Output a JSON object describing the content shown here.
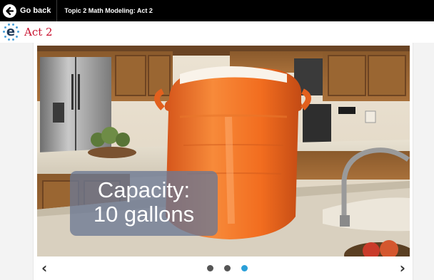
{
  "topbar": {
    "back_label": "Go back",
    "topic_title": "Topic 2 Math Modeling: Act 2"
  },
  "header": {
    "logo_icon": "e-logo-icon",
    "title": "Act 2"
  },
  "slide": {
    "caption_line1": "Capacity:",
    "caption_line2": "10 gallons",
    "image_subject": "orange water cooler on kitchen counter"
  },
  "carousel": {
    "prev_icon": "chevron-left-icon",
    "next_icon": "chevron-right-icon",
    "prev_label": "‹",
    "next_label": "›",
    "total_slides": 3,
    "active_index": 3
  },
  "colors": {
    "topbar_bg": "#000000",
    "title_red": "#c8102e",
    "active_dot": "#2a9fd8",
    "inactive_dot": "#555555",
    "cooler_orange": "#f26d1f"
  }
}
